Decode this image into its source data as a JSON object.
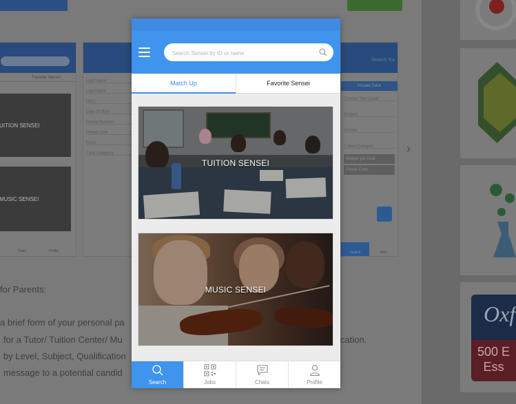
{
  "background": {
    "left_texts": [
      "for Parents:",
      "a brief form of your personal pa",
      "for a Tutor/ Tuition Center/ Mu",
      "by Level, Subject, Qualification",
      "message to a potential candid"
    ],
    "right_texts": [
      "cation."
    ],
    "phone_left": {
      "mini_tabs": [
        "Favorite Sensei"
      ],
      "cards": [
        "UITION SENSEI",
        "MUSIC SENSEI"
      ],
      "nav": [
        "Chats",
        "Profile"
      ]
    },
    "phone_middle": {
      "fields": [
        "Last Name",
        "Last Name",
        "NRIC",
        "Date Of Birth",
        "Mobile Number",
        "Postal code",
        "Race",
        "Tutor Category"
      ]
    },
    "phone_right": {
      "title": "Search Tut",
      "highlight": "Private Tutor",
      "fields": [
        "Choose Your Level",
        "Subject",
        "Gender",
        "Tuition Category"
      ],
      "dark_fields": [
        "Budget per hour",
        "Postal Code"
      ],
      "nav": [
        "Search",
        "Jobs"
      ]
    },
    "ad": {
      "brand": "Oxf",
      "line1": "500 E",
      "line2": "Ess"
    }
  },
  "app": {
    "search_placeholder": "Search Sensei by ID or name",
    "tabs": [
      "Match Up",
      "Favorite Sensei"
    ],
    "active_tab": "Match Up",
    "cards": {
      "tuition": "TUITION SENSEI",
      "music": "MUSIC SENSEI"
    },
    "nav": {
      "search": "Search",
      "jobs": "Jobs",
      "chats": "Chats",
      "profile": "Profile"
    },
    "active_nav": "Search"
  },
  "colors": {
    "primary": "#3f94ee",
    "status_strip": "#3f8be3",
    "active_tab": "#3f8ee8",
    "overlay_bg": "#7a7a7a"
  },
  "icons": [
    "menu-icon",
    "search-icon",
    "qr-code-icon",
    "chat-icon",
    "person-icon",
    "chevron-right-icon"
  ]
}
